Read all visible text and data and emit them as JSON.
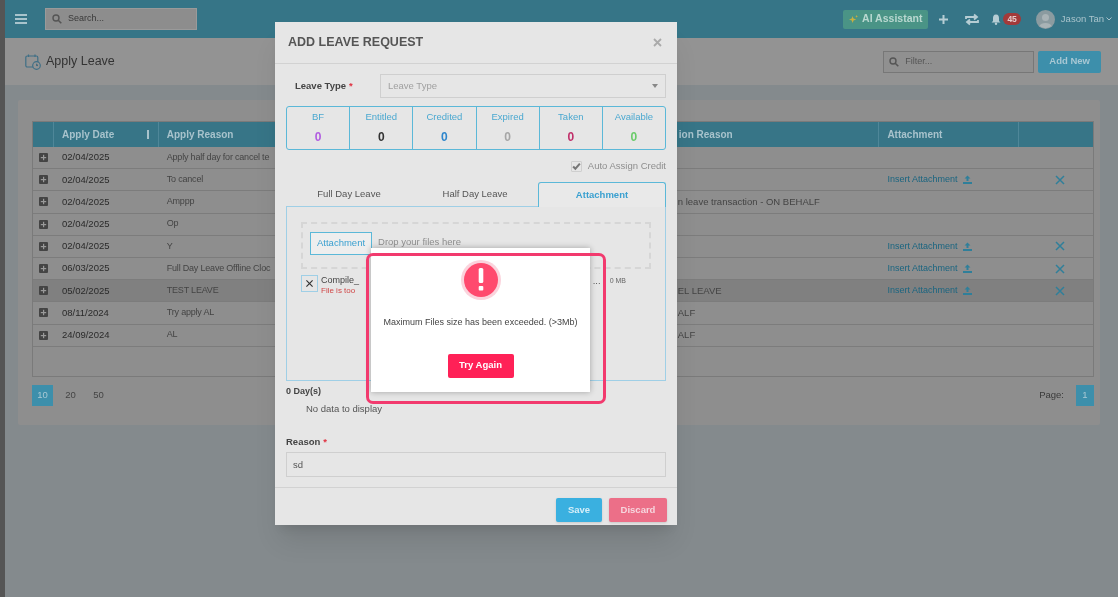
{
  "topbar": {
    "search_placeholder": "Search...",
    "ai_button": "AI Assistant",
    "notification_count": "45",
    "user_name": "Jason Tan"
  },
  "page": {
    "title": "Apply Leave",
    "filter_placeholder": "Filter...",
    "add_button": "Add New"
  },
  "table": {
    "columns": [
      "Apply Date",
      "Apply Reason",
      "ion Reason",
      "Attachment"
    ],
    "rows": [
      {
        "apply_date": "02/04/2025",
        "apply_reason": "Apply half day for cancel te",
        "deletable": false,
        "selected": false
      },
      {
        "apply_date": "02/04/2025",
        "apply_reason": "To cancel",
        "attachment": "Insert Attachment",
        "deletable": true,
        "selected": false
      },
      {
        "apply_date": "02/04/2025",
        "apply_reason": "Amppp",
        "reason_tail": "n leave transaction - ON BEHALF",
        "deletable": false,
        "selected": false
      },
      {
        "apply_date": "02/04/2025",
        "apply_reason": "Op",
        "deletable": false,
        "selected": false
      },
      {
        "apply_date": "02/04/2025",
        "apply_reason": "Y",
        "attachment": "Insert Attachment",
        "deletable": true,
        "selected": false
      },
      {
        "apply_date": "06/03/2025",
        "apply_reason": "Full Day Leave Offline Cloc",
        "attachment": "Insert Attachment",
        "deletable": true,
        "selected": false
      },
      {
        "apply_date": "05/02/2025",
        "apply_reason": "TEST LEAVE",
        "reason_tail": "EL LEAVE",
        "attachment": "Insert Attachment",
        "deletable": true,
        "selected": true
      },
      {
        "apply_date": "08/11/2024",
        "apply_reason": "Try apply AL",
        "reason_tail": "ALF",
        "deletable": false,
        "selected": false
      },
      {
        "apply_date": "24/09/2024",
        "apply_reason": "AL",
        "reason_tail": "ALF",
        "deletable": false,
        "selected": false
      }
    ]
  },
  "pagination": {
    "page_sizes": [
      {
        "label": "10",
        "selected": true
      },
      {
        "label": "20",
        "selected": false
      },
      {
        "label": "50",
        "selected": false
      }
    ],
    "page_label": "Page:",
    "pages": [
      {
        "label": "1",
        "selected": true
      }
    ]
  },
  "modal": {
    "title": "ADD LEAVE REQUEST",
    "leave_type_label": "Leave Type",
    "required_mark": "*",
    "leave_type_placeholder": "Leave Type",
    "balances": [
      {
        "label": "BF",
        "value": "0",
        "color": "#b05ce0"
      },
      {
        "label": "Entitled",
        "value": "0",
        "color": "#333333"
      },
      {
        "label": "Credited",
        "value": "0",
        "color": "#2f86cc"
      },
      {
        "label": "Expired",
        "value": "0",
        "color": "#a6a6a6"
      },
      {
        "label": "Taken",
        "value": "0",
        "color": "#c0306a"
      },
      {
        "label": "Available",
        "value": "0",
        "color": "#6acb6a"
      }
    ],
    "auto_assign": {
      "label": "Auto Assign Credit",
      "checked": true,
      "disabled": true
    },
    "tabs": [
      {
        "label": "Full Day Leave",
        "selected": false
      },
      {
        "label": "Half Day Leave",
        "selected": false
      },
      {
        "label": "Attachment",
        "selected": true
      }
    ],
    "upload_button": "Attachment",
    "drop_placeholder": "Drop your files here",
    "file": {
      "name": "Compile_",
      "error": "File is too",
      "ellipsis": "...",
      "size": "0 MB"
    },
    "days": "0 Day(s)",
    "no_data": "No data to display",
    "reason_label": "Reason",
    "reason_required_mark": "*",
    "reason_value": "sd",
    "buttons": [
      {
        "label": "Save",
        "kind": "primary"
      },
      {
        "label": "Discard",
        "kind": "danger"
      }
    ]
  },
  "alert": {
    "message": "Maximum Files size has been exceeded. (>3Mb)",
    "button": "Try Again"
  }
}
